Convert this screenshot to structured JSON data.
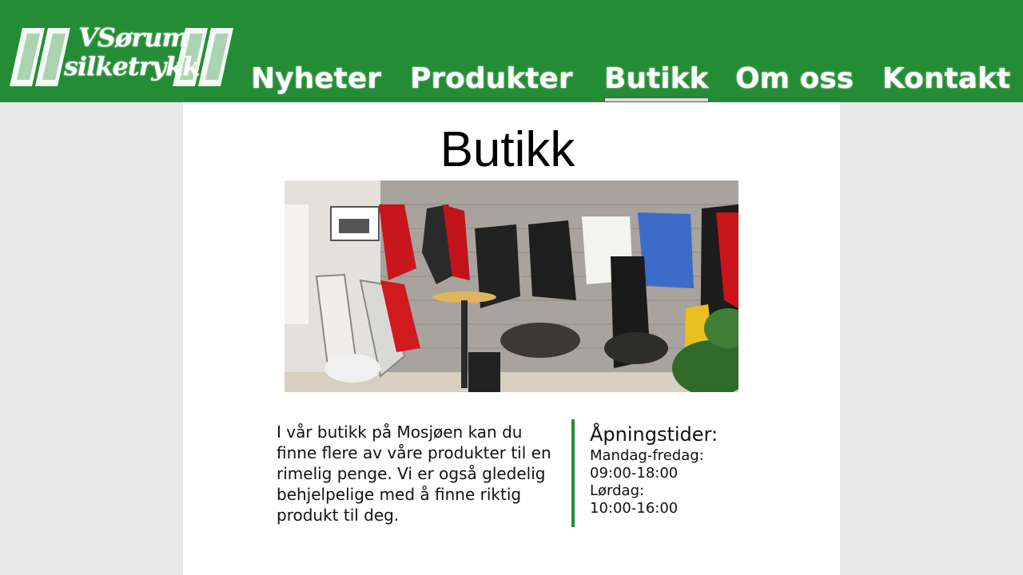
{
  "header": {
    "logo": {
      "line1": "Sørum",
      "line2": "silketrykk",
      "prefix": "V",
      "alt": "V. Sørum silketrykk logo"
    },
    "nav": [
      {
        "label": "Nyheter",
        "active": false
      },
      {
        "label": "Produkter",
        "active": false
      },
      {
        "label": "Butikk",
        "active": true
      },
      {
        "label": "Om oss",
        "active": false
      },
      {
        "label": "Kontakt",
        "active": false
      }
    ]
  },
  "main": {
    "title": "Butikk",
    "description": "I vår butikk på Mosjøen kan du finne flere av våre produkter til en rimelig penge. Vi er også gledelig behjelpelige med å finne riktig produkt til deg.",
    "hours": {
      "title": "Åpningstider:",
      "weekday_label": "Mandag-fredag:",
      "weekday_time": "09:00-18:00",
      "saturday_label": "Lørdag:",
      "saturday_time": "10:00-16:00"
    }
  },
  "colors": {
    "brand_green": "#248c34",
    "page_bg": "#e8e8e8",
    "content_bg": "#ffffff"
  }
}
